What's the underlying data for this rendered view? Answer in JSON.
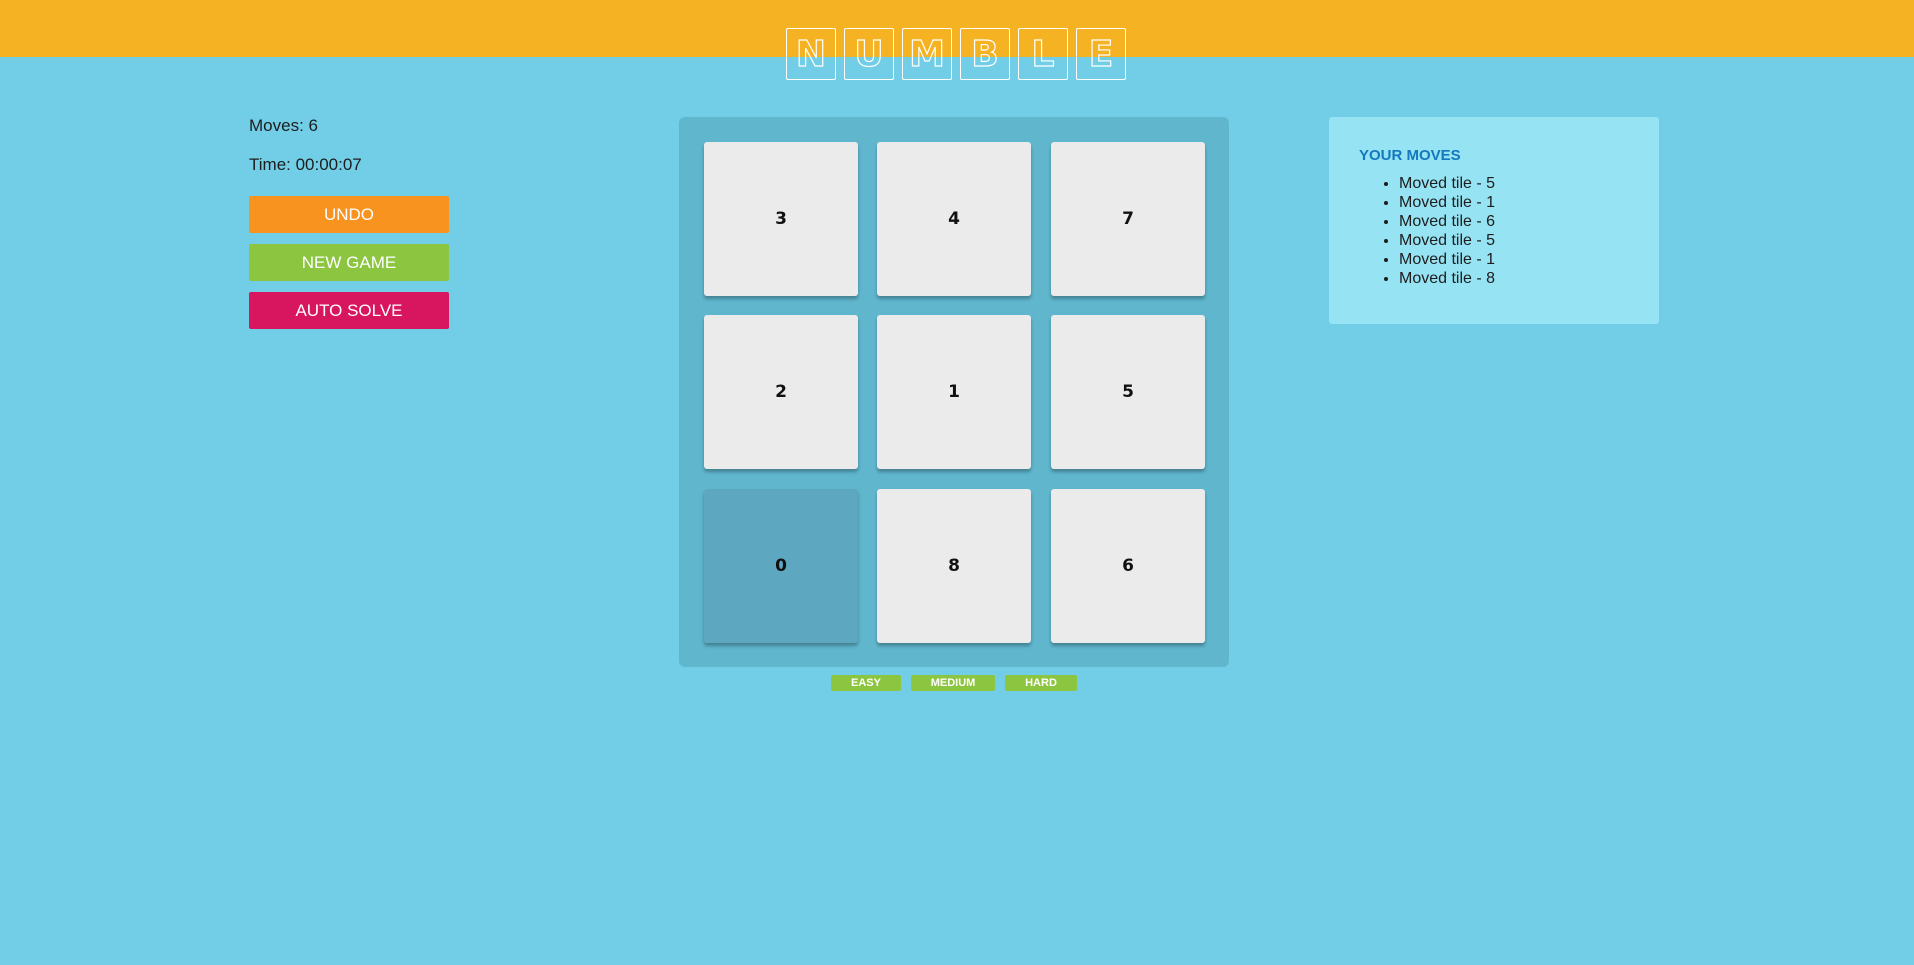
{
  "logo": {
    "letters": [
      "N",
      "U",
      "M",
      "B",
      "L",
      "E"
    ]
  },
  "colors": {
    "background": "#72cee7",
    "topbar": "#f5b222",
    "undo": "#f7931e",
    "new_game": "#8cc53f",
    "auto_solve": "#d8155f",
    "board": "#5fb6cd",
    "tile": "#ebebeb",
    "empty_tile": "#5da8c0",
    "moves_panel": "#95e3f3",
    "moves_title": "#1478bd"
  },
  "stats": {
    "moves": "Moves: 6",
    "time": "Time: 00:00:07"
  },
  "buttons": {
    "undo": "UNDO",
    "new_game": "NEW GAME",
    "auto_solve": "AUTO SOLVE"
  },
  "board": {
    "tiles": [
      "3",
      "4",
      "7",
      "2",
      "1",
      "5",
      "0",
      "8",
      "6"
    ],
    "empty_value": "0"
  },
  "difficulty": {
    "easy": "EASY",
    "medium": "MEDIUM",
    "hard": "HARD"
  },
  "moves_panel": {
    "title": "YOUR MOVES",
    "items": [
      "Moved tile - 5",
      "Moved tile - 1",
      "Moved tile - 6",
      "Moved tile - 5",
      "Moved tile - 1",
      "Moved tile - 8"
    ]
  }
}
